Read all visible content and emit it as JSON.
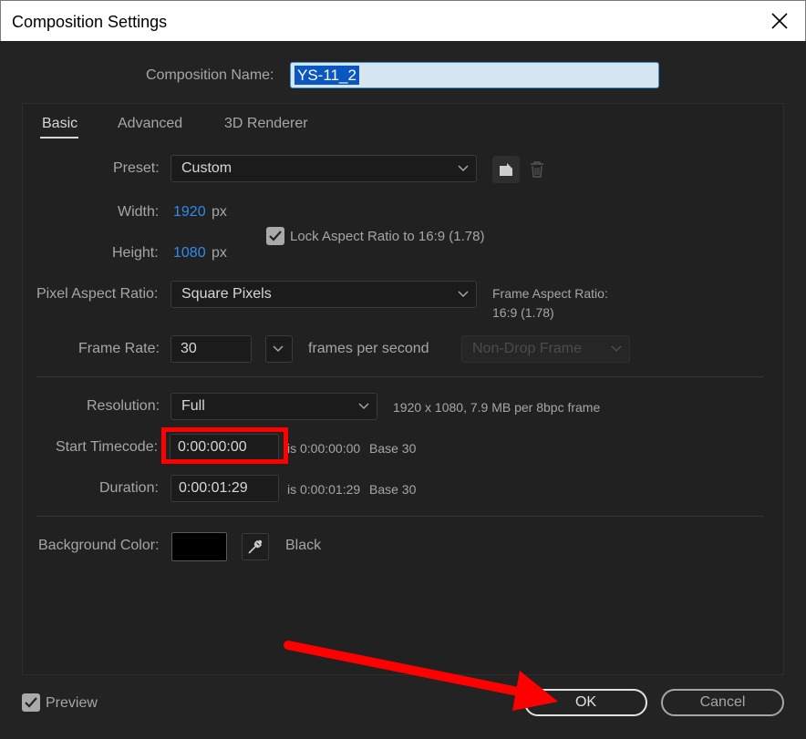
{
  "window": {
    "title": "Composition Settings"
  },
  "composition_name": {
    "label": "Composition Name:",
    "value": "YS-11_2"
  },
  "tabs": [
    {
      "label": "Basic",
      "active": true
    },
    {
      "label": "Advanced",
      "active": false
    },
    {
      "label": "3D Renderer",
      "active": false
    }
  ],
  "preset": {
    "label": "Preset:",
    "value": "Custom"
  },
  "width": {
    "label": "Width:",
    "value": "1920",
    "unit": "px"
  },
  "height": {
    "label": "Height:",
    "value": "1080",
    "unit": "px"
  },
  "lock_aspect": {
    "label": "Lock Aspect Ratio to 16:9 (1.78)",
    "checked": true
  },
  "pixel_aspect": {
    "label": "Pixel Aspect Ratio:",
    "value": "Square Pixels"
  },
  "frame_aspect": {
    "label": "Frame Aspect Ratio:",
    "value": "16:9 (1.78)"
  },
  "frame_rate": {
    "label": "Frame Rate:",
    "value": "30",
    "unit": "frames per second",
    "drop_frame": "Non-Drop Frame"
  },
  "resolution": {
    "label": "Resolution:",
    "value": "Full",
    "info": "1920 x 1080, 7.9 MB per 8bpc frame"
  },
  "start_timecode": {
    "label": "Start Timecode:",
    "value": "0:00:00:00",
    "is_text": "is 0:00:00:00",
    "base": "Base 30"
  },
  "duration": {
    "label": "Duration:",
    "value": "0:00:01:29",
    "is_text": "is 0:00:01:29",
    "base": "Base 30"
  },
  "background": {
    "label": "Background Color:",
    "color": "#000000",
    "name": "Black"
  },
  "footer": {
    "preview_label": "Preview",
    "preview_checked": true,
    "ok_label": "OK",
    "cancel_label": "Cancel"
  },
  "colors": {
    "accent_blue": "#2d8ceb",
    "annotation_red": "#ff0000",
    "dialog_bg": "#232323"
  }
}
